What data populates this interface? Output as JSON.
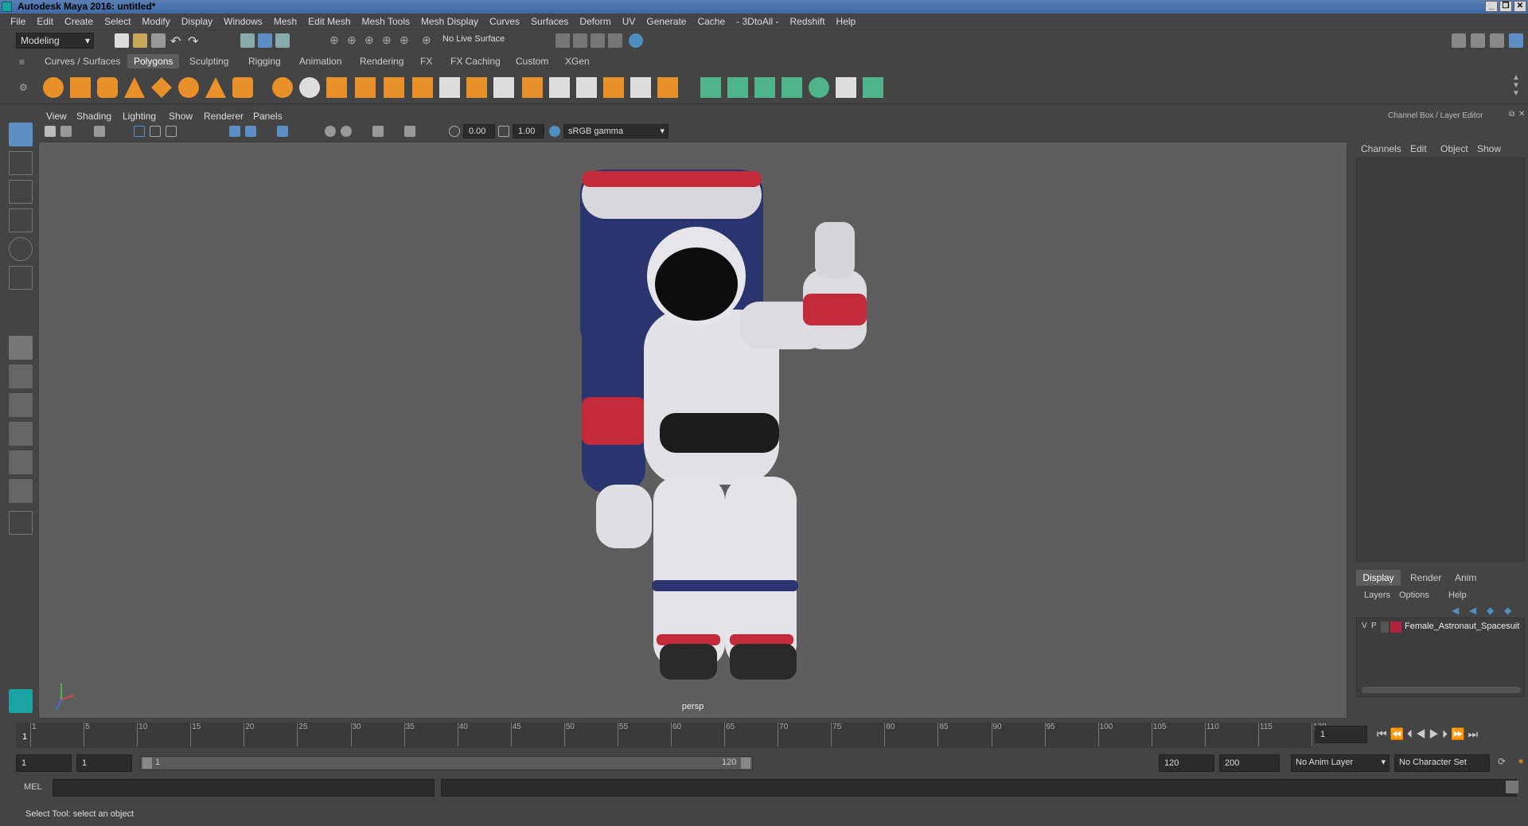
{
  "window": {
    "title": "Autodesk Maya 2016: untitled*"
  },
  "menus": [
    "File",
    "Edit",
    "Create",
    "Select",
    "Modify",
    "Display",
    "Windows",
    "Mesh",
    "Edit Mesh",
    "Mesh Tools",
    "Mesh Display",
    "Curves",
    "Surfaces",
    "Deform",
    "UV",
    "Generate",
    "Cache",
    "- 3DtoAll -",
    "Redshift",
    "Help"
  ],
  "statusline": {
    "mode": "Modeling",
    "live_surface": "No Live Surface"
  },
  "shelf": {
    "tabs": [
      "Curves / Surfaces",
      "Polygons",
      "Sculpting",
      "Rigging",
      "Animation",
      "Rendering",
      "FX",
      "FX Caching",
      "Custom",
      "XGen"
    ],
    "active_tab": "Polygons"
  },
  "panel": {
    "menus": [
      "View",
      "Shading",
      "Lighting",
      "Show",
      "Renderer",
      "Panels"
    ],
    "exposure": "0.00",
    "gamma": "1.00",
    "color_space": "sRGB gamma",
    "camera": "persp"
  },
  "channelbox": {
    "title": "Channel Box / Layer Editor",
    "menus": [
      "Channels",
      "Edit",
      "Object",
      "Show"
    ]
  },
  "layereditor": {
    "tabs": [
      "Display",
      "Render",
      "Anim"
    ],
    "active_tab": "Display",
    "menus": [
      "Layers",
      "Options",
      "Help"
    ],
    "layers": [
      {
        "v": "V",
        "p": "P",
        "name": "Female_Astronaut_Spacesuit",
        "color": "#b0233a"
      }
    ]
  },
  "timeslider": {
    "ticks": [
      "1",
      "5",
      "10",
      "15",
      "20",
      "25",
      "30",
      "35",
      "40",
      "45",
      "50",
      "55",
      "60",
      "65",
      "70",
      "75",
      "80",
      "85",
      "90",
      "95",
      "100",
      "105",
      "110",
      "115",
      "120"
    ],
    "current_frame": "1"
  },
  "rangeslider": {
    "start": "1",
    "anim_start": "1",
    "range_start_label": "1",
    "range_end_label": "120",
    "anim_end": "120",
    "end": "200",
    "anim_layer": "No Anim Layer",
    "character_set": "No Character Set"
  },
  "cmdline": {
    "label": "MEL"
  },
  "helpline": {
    "text": "Select Tool: select an object"
  },
  "colors": {
    "accent": "#5d8fc5",
    "viewport_bg": "#5e5e5e",
    "shelf_icon": "#e8902a",
    "shelf_icon_green": "#4fb38c"
  }
}
